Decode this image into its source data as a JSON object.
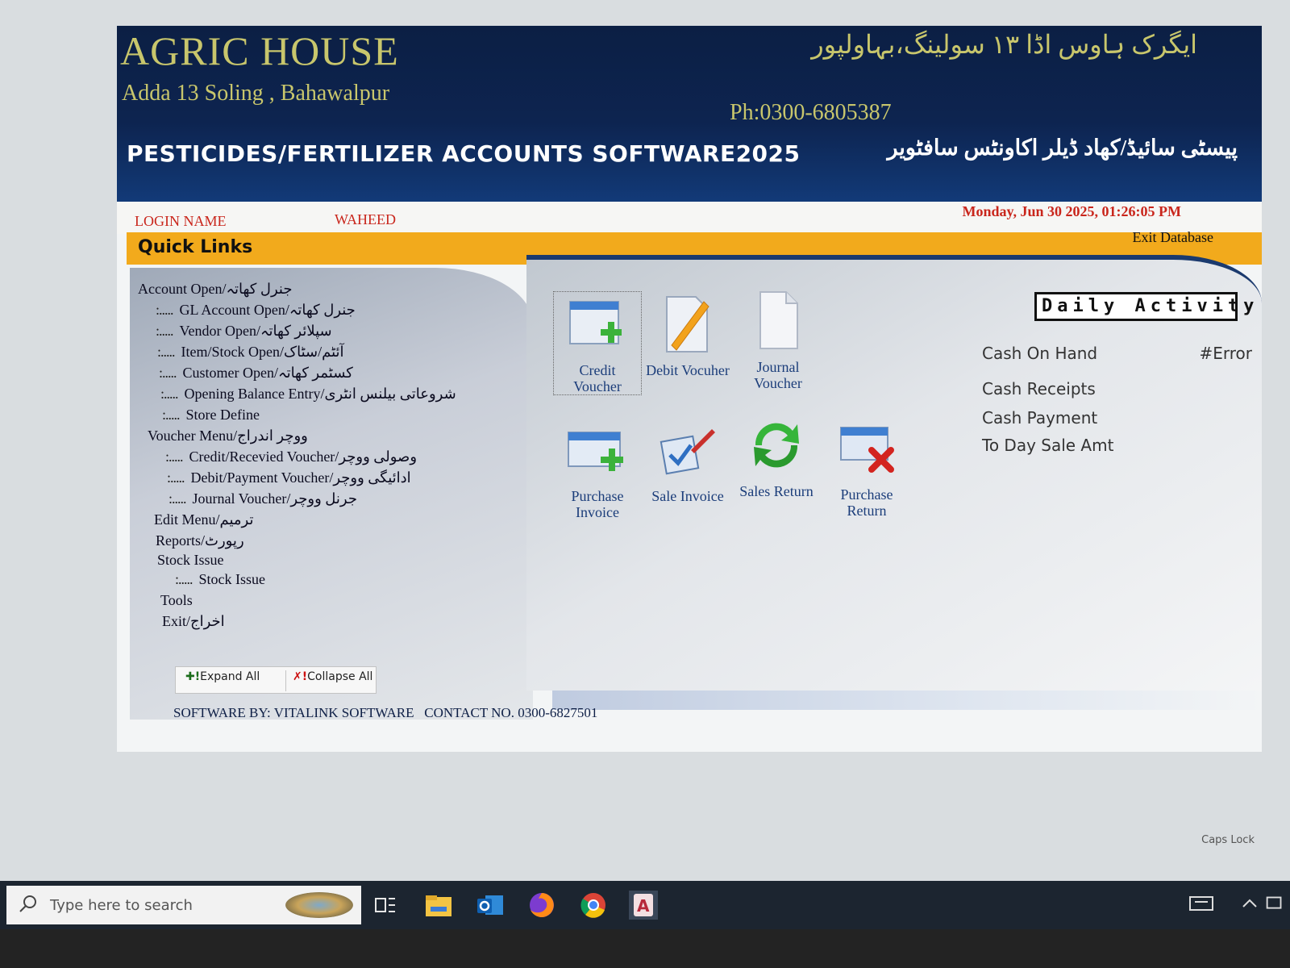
{
  "header": {
    "company_name": "AGRIC HOUSE",
    "address": "Adda 13 Soling , Bahawalpur",
    "urdu_title": "ایگرک ہاوس اڈا ۱۳ سولینگ،بہاولپور",
    "phone": "Ph:0300-6805387",
    "tagline": "PESTICIDES/FERTILIZER ACCOUNTS SOFTWARE2025",
    "tagline_urdu": "پیسٹی سائیڈ/کھاد ڈیلر اکاونٹس سافٹویر"
  },
  "session": {
    "login_label": "LOGIN NAME",
    "user": "WAHEED",
    "datetime": "Monday, Jun 30 2025, 01:26:05 PM",
    "exit_database": "Exit Database"
  },
  "quick_links_label": "Quick Links",
  "tree": {
    "items": [
      {
        "label": "Account Open/جنرل کھاتہ",
        "level": 0
      },
      {
        "label": "GL Account Open/جنرل کھاتہ",
        "level": 1
      },
      {
        "label": "Vendor Open/سپلائر کھاتہ",
        "level": 1
      },
      {
        "label": "Item/Stock Open/آئٹم/سٹاک",
        "level": 1
      },
      {
        "label": "Customer Open/کسٹمر کھاتہ",
        "level": 1
      },
      {
        "label": "Opening Balance Entry/شروعاتی بیلنس انٹری",
        "level": 1
      },
      {
        "label": "Store Define",
        "level": 1
      },
      {
        "label": "Voucher Menu/ووچر اندراج",
        "level": 0
      },
      {
        "label": "Credit/Recevied Voucher/وصولی ووچر",
        "level": 1
      },
      {
        "label": "Debit/Payment Voucher/ادائیگی ووچر",
        "level": 1
      },
      {
        "label": "Journal Voucher/جرنل ووچر",
        "level": 1
      },
      {
        "label": "Edit Menu/ترمیم",
        "level": 0
      },
      {
        "label": "Reports/رپورٹ",
        "level": 0
      },
      {
        "label": "Stock Issue",
        "level": 0
      },
      {
        "label": "Stock Issue",
        "level": 1
      },
      {
        "label": "Tools",
        "level": 0
      },
      {
        "label": "Exit/اخراج",
        "level": 0
      }
    ],
    "expand_all": "Expand All",
    "collapse_all": "Collapse All"
  },
  "footer": {
    "software_by": "SOFTWARE BY: VITALINK SOFTWARE",
    "contact": "CONTACT NO. 0300-6827501"
  },
  "shortcuts": {
    "credit_voucher": "Credit Voucher",
    "debit_voucher": "Debit Vocuher",
    "journal_voucher": "Journal Voucher",
    "purchase_invoice": "Purchase Invoice",
    "sale_invoice": "Sale Invoice",
    "sales_return": "Sales Return",
    "purchase_return": "Purchase Return"
  },
  "daily_activity": {
    "title": "Daily Activity",
    "cash_on_hand_label": "Cash On Hand",
    "cash_on_hand_value": "#Error",
    "cash_receipts_label": "Cash Receipts",
    "cash_payment_label": "Cash Payment",
    "today_sale_label": "To Day Sale Amt"
  },
  "taskbar": {
    "search_placeholder": "Type here to search",
    "caps_lock": "Caps Lock"
  },
  "colors": {
    "banner": "#0d2450",
    "gold": "#c8c66c",
    "accent_orange": "#f2aa1c",
    "alert_red": "#c9261c"
  }
}
